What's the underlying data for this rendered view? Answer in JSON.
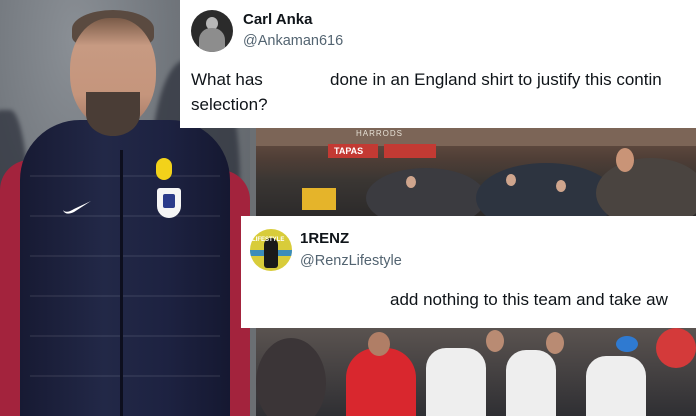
{
  "tweet1": {
    "name": "Carl Anka",
    "handle": "@Ankaman616",
    "line1_part1": "What has",
    "line1_part2": "done in an England shirt to justify this contin",
    "line2": "selection?"
  },
  "tweet2": {
    "name": "1RENZ",
    "handle": "@RenzLifestyle",
    "avatar_text": "LIFESTYLE",
    "text": "add nothing to this team and take aw"
  },
  "photo": {
    "storefront_sign": "TAPAS",
    "banner_text": "HARRODS"
  },
  "colors": {
    "tweet_bg": "#ffffff",
    "text_primary": "#0f1419",
    "text_secondary": "#536471",
    "jacket_navy": "#1d2241",
    "shirt_red": "#a3233d"
  }
}
